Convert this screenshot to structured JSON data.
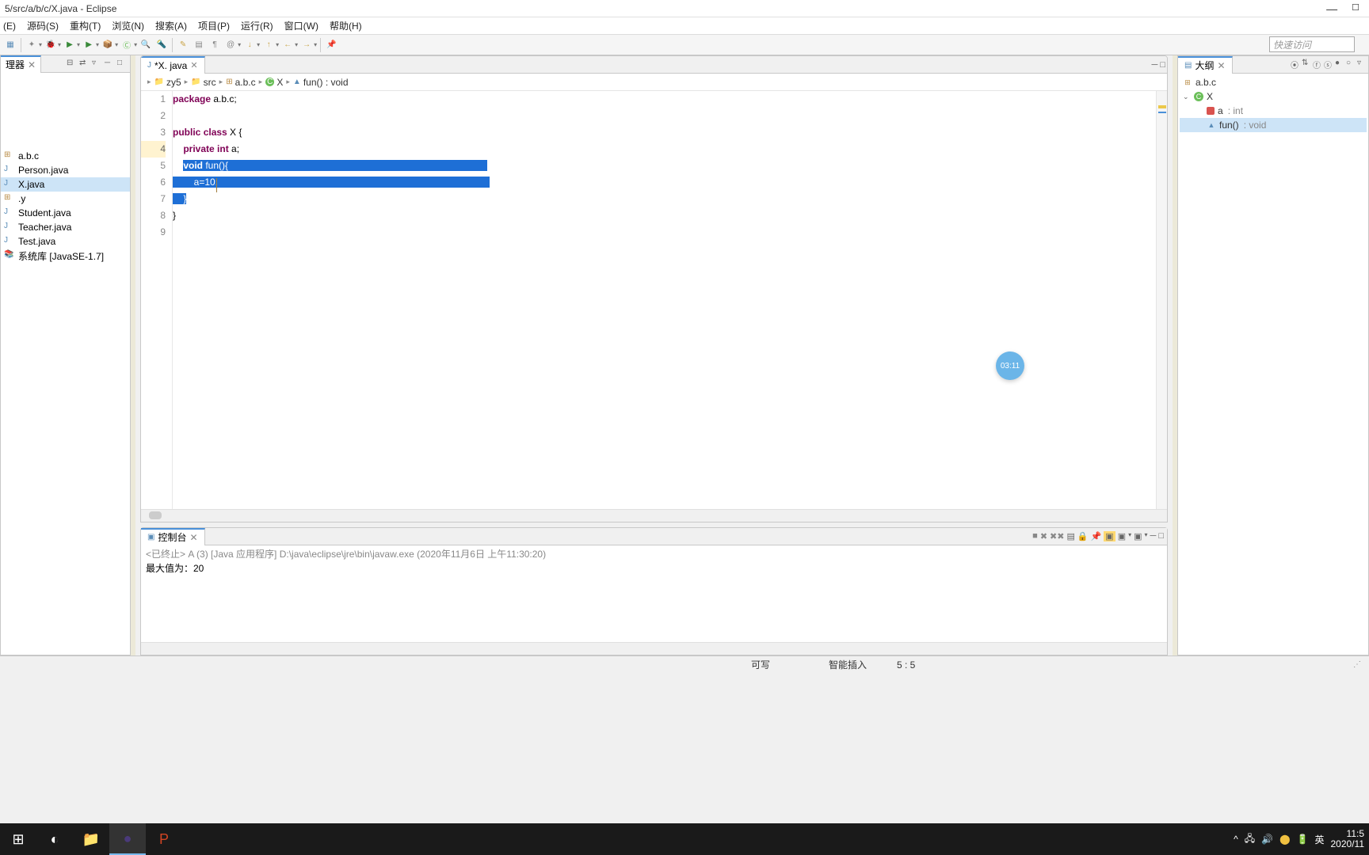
{
  "window": {
    "title": "5/src/a/b/c/X.java - Eclipse"
  },
  "menu": [
    "(E)",
    "源码(S)",
    "重构(T)",
    "浏览(N)",
    "搜索(A)",
    "项目(P)",
    "运行(R)",
    "窗口(W)",
    "帮助(H)"
  ],
  "quick_access": "快速访问",
  "left_panel": {
    "tab": "理器"
  },
  "tree_items": [
    {
      "label": "a.b.c",
      "icon": "pkg"
    },
    {
      "label": "Person.java",
      "icon": "ju"
    },
    {
      "label": "X.java",
      "icon": "ju",
      "selected": true
    },
    {
      "label": ".y",
      "icon": "pkg"
    },
    {
      "label": "Student.java",
      "icon": "ju"
    },
    {
      "label": "Teacher.java",
      "icon": "ju"
    },
    {
      "label": "Test.java",
      "icon": "ju"
    },
    {
      "label": "系统库 [JavaSE-1.7]",
      "icon": "lib"
    }
  ],
  "editor": {
    "tab_name": "*X. java",
    "breadcrumb": [
      "zy5",
      "src",
      "a.b.c",
      "X",
      "fun() : void"
    ]
  },
  "code_lines": [
    {
      "n": 1,
      "html": "<span class='kw'>package</span> a.b.c;"
    },
    {
      "n": 2,
      "html": ""
    },
    {
      "n": 3,
      "html": "<span class='kw'>public</span> <span class='kw'>class</span> X {"
    },
    {
      "n": 4,
      "html": "    <span class='kw'>private</span> <span class='kw'>int</span> a;",
      "warn": true
    },
    {
      "n": 5,
      "html": "    <span class='sel-bg'><span class='kw'>void</span> fun(){                                                                                                  </span>",
      "sel": true
    },
    {
      "n": 6,
      "html": "<span class='sel-bg'>        a=10;                                                                                                       </span>",
      "sel": true
    },
    {
      "n": 7,
      "html": "<span class='sel-bg'>    }</span>",
      "sel": true
    },
    {
      "n": 8,
      "html": "}"
    },
    {
      "n": 9,
      "html": ""
    }
  ],
  "outline": {
    "tab": "大纲",
    "items": [
      {
        "label": "a.b.c",
        "type": "",
        "icon": "pkg",
        "level": 0
      },
      {
        "label": "X",
        "type": "",
        "icon": "class",
        "level": 0,
        "expand": "v"
      },
      {
        "label": "a",
        "type": ": int",
        "icon": "field",
        "level": 2
      },
      {
        "label": "fun()",
        "type": ": void",
        "icon": "method",
        "level": 2,
        "selected": true
      }
    ]
  },
  "console": {
    "tab": "控制台",
    "header": "<已终止> A (3) [Java 应用程序] D:\\java\\eclipse\\jre\\bin\\javaw.exe (2020年11月6日 上午11:30:20)",
    "output": "最大值为：20"
  },
  "status": {
    "writable": "可写",
    "insert": "智能插入",
    "pos": "5 : 5"
  },
  "timer": "03:11",
  "taskbar": {
    "time1": "11:5",
    "time2": "2020/11",
    "ime": "英"
  }
}
